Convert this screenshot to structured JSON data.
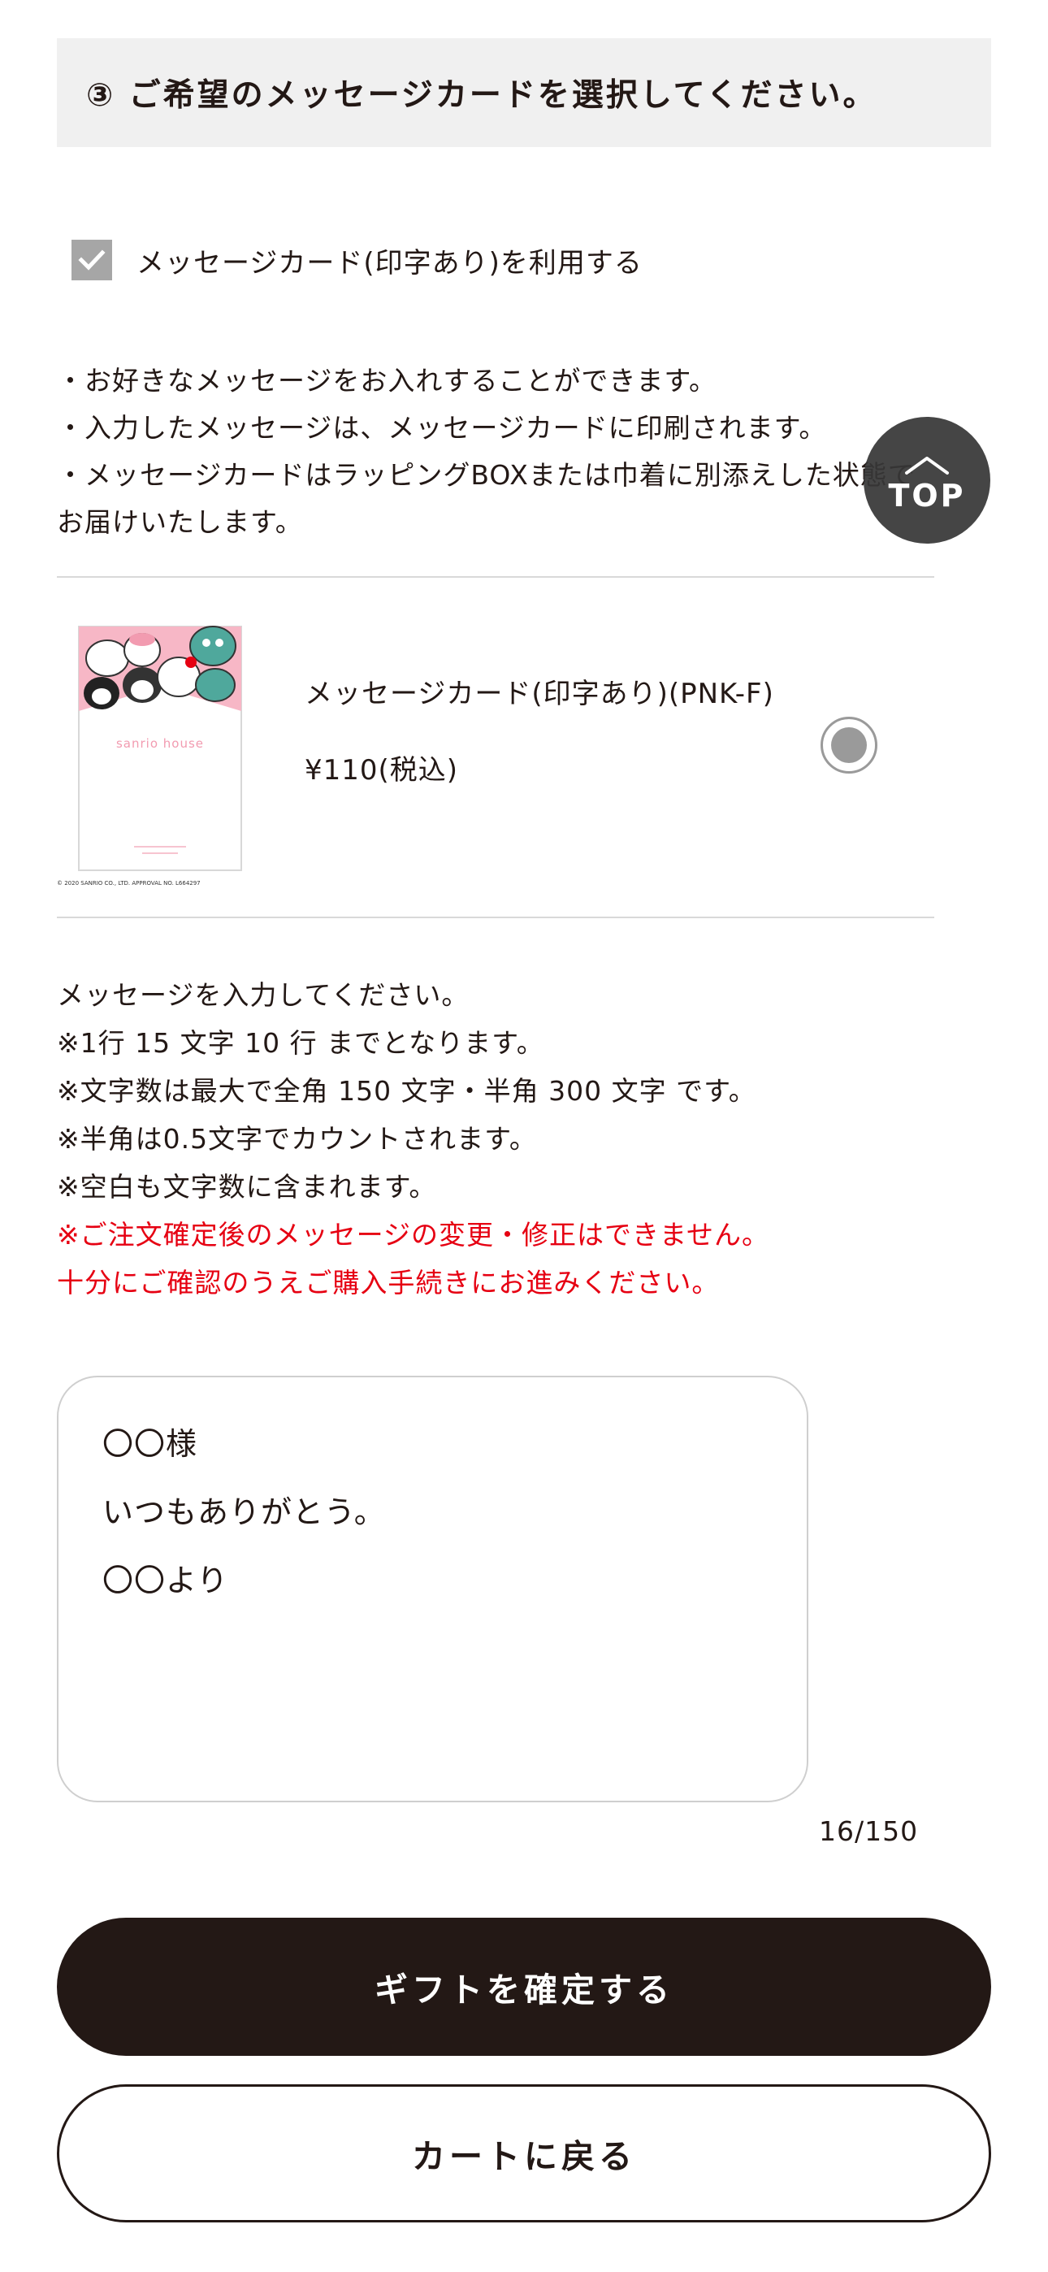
{
  "section": {
    "title": "③ ご希望のメッセージカードを選択してください。"
  },
  "checkbox": {
    "label": "メッセージカード(印字あり)を利用する",
    "checked": true
  },
  "notes": [
    "・お好きなメッセージをお入れすることができます。",
    "・入力したメッセージは、メッセージカードに印刷されます。",
    "・メッセージカードはラッピングBOXまたは巾着に別添えした状態で",
    "お届けいたします。"
  ],
  "top_button": {
    "label": "TOP",
    "icon": "chevron-up-icon"
  },
  "product": {
    "name": "メッセージカード(印字あり)(PNK-F)",
    "price": "¥110(税込)",
    "selected": true,
    "card": {
      "brand": "sanrio house",
      "copyright": "© 2020 SANRIO CO., LTD. APPROVAL NO. L664297",
      "colors": {
        "pink": "#f7b7c6",
        "brand_text": "#f29bb0"
      }
    }
  },
  "instructions": {
    "lines": [
      "メッセージを入力してください。",
      "※1行 15 文字 10 行 までとなります。",
      "※文字数は最大で全角 150 文字・半角 300 文字 です。",
      "※半角は0.5文字でカウントされます。",
      "※空白も文字数に含まれます。"
    ],
    "warnings": [
      "※ご注文確定後のメッセージの変更・修正はできません。",
      "十分にご確認のうえご購入手続きにお進みください。"
    ]
  },
  "message": {
    "lines": [
      "〇〇様",
      "いつもありがとう。",
      "〇〇より"
    ],
    "count": "16/150"
  },
  "buttons": {
    "confirm": "ギフトを確定する",
    "back": "カートに戻る"
  },
  "colors": {
    "primary_dark": "#231815",
    "warning_red": "#e60012",
    "header_bg": "#f0f0f0",
    "checkbox_gray": "#a6a6a6"
  }
}
